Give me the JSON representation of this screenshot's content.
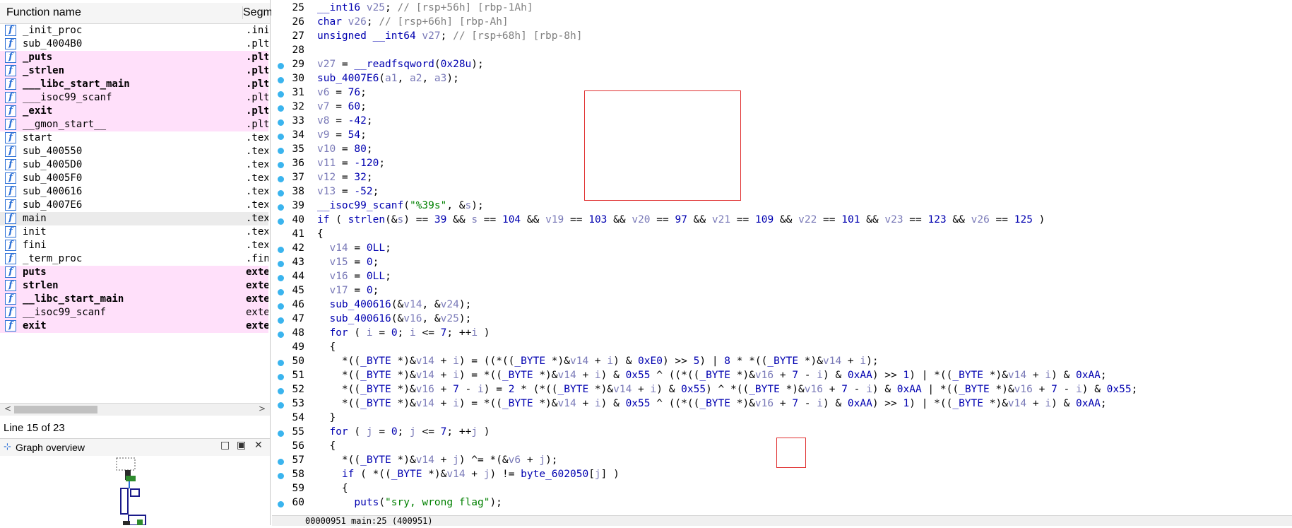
{
  "function_list": {
    "header_name": "Function name",
    "header_segment": "Segment",
    "icon_glyph": "f",
    "rows": [
      {
        "name": "_init_proc",
        "seg": ".init",
        "hl": false,
        "bold": false
      },
      {
        "name": "sub_4004B0",
        "seg": ".plt",
        "hl": false,
        "bold": false
      },
      {
        "name": "_puts",
        "seg": ".plt",
        "hl": true,
        "bold": true
      },
      {
        "name": "_strlen",
        "seg": ".plt",
        "hl": true,
        "bold": true
      },
      {
        "name": "___libc_start_main",
        "seg": ".plt",
        "hl": true,
        "bold": true
      },
      {
        "name": "___isoc99_scanf",
        "seg": ".plt",
        "hl": true,
        "bold": false
      },
      {
        "name": "_exit",
        "seg": ".plt",
        "hl": true,
        "bold": true
      },
      {
        "name": "__gmon_start__",
        "seg": ".plt",
        "hl": true,
        "bold": false
      },
      {
        "name": "start",
        "seg": ".text",
        "hl": false,
        "bold": false
      },
      {
        "name": "sub_400550",
        "seg": ".text",
        "hl": false,
        "bold": false
      },
      {
        "name": "sub_4005D0",
        "seg": ".text",
        "hl": false,
        "bold": false
      },
      {
        "name": "sub_4005F0",
        "seg": ".text",
        "hl": false,
        "bold": false
      },
      {
        "name": "sub_400616",
        "seg": ".text",
        "hl": false,
        "bold": false
      },
      {
        "name": "sub_4007E6",
        "seg": ".text",
        "hl": false,
        "bold": false
      },
      {
        "name": "main",
        "seg": ".text",
        "hl": false,
        "bold": false,
        "sel": true
      },
      {
        "name": "init",
        "seg": ".text",
        "hl": false,
        "bold": false
      },
      {
        "name": "fini",
        "seg": ".text",
        "hl": false,
        "bold": false
      },
      {
        "name": "_term_proc",
        "seg": ".fini",
        "hl": false,
        "bold": false
      },
      {
        "name": "puts",
        "seg": "extern",
        "hl": true,
        "bold": true
      },
      {
        "name": "strlen",
        "seg": "extern",
        "hl": true,
        "bold": true
      },
      {
        "name": "__libc_start_main",
        "seg": "extern",
        "hl": true,
        "bold": true
      },
      {
        "name": "__isoc99_scanf",
        "seg": "extern",
        "hl": true,
        "bold": false
      },
      {
        "name": "exit",
        "seg": "extern",
        "hl": true,
        "bold": true
      }
    ],
    "status": "Line 15 of 23"
  },
  "graph_overview": {
    "title": "Graph overview",
    "pin_glyph": "□",
    "float_glyph": "▣",
    "close_glyph": "✕"
  },
  "scroll": {
    "left_arrow": "<",
    "right_arrow": ">"
  },
  "code": {
    "lines": [
      {
        "n": "25",
        "dot": false,
        "html": "<span class=\"k\">__int16</span> <span class=\"v\">v25</span>; <span class=\"g\">// [rsp+56h] [rbp-1Ah]</span>"
      },
      {
        "n": "26",
        "dot": false,
        "html": "<span class=\"k\">char</span> <span class=\"v\">v26</span>; <span class=\"g\">// [rsp+66h] [rbp-Ah]</span>"
      },
      {
        "n": "27",
        "dot": false,
        "html": "<span class=\"k\">unsigned __int64</span> <span class=\"v\">v27</span>; <span class=\"g\">// [rsp+68h] [rbp-8h]</span>"
      },
      {
        "n": "28",
        "dot": false,
        "html": ""
      },
      {
        "n": "29",
        "dot": true,
        "html": "<span class=\"v\">v27</span> = <span class=\"k\">__readfsqword</span>(<span class=\"k\">0x28u</span>);"
      },
      {
        "n": "30",
        "dot": true,
        "html": "<span class=\"k\">sub_4007E6</span>(<span class=\"v\">a1</span>, <span class=\"v\">a2</span>, <span class=\"v\">a3</span>);"
      },
      {
        "n": "31",
        "dot": true,
        "html": "<span class=\"v\">v6</span> = <span class=\"k\">76</span>;"
      },
      {
        "n": "32",
        "dot": true,
        "html": "<span class=\"v\">v7</span> = <span class=\"k\">60</span>;"
      },
      {
        "n": "33",
        "dot": true,
        "html": "<span class=\"v\">v8</span> = <span class=\"k\">-42</span>;"
      },
      {
        "n": "34",
        "dot": true,
        "html": "<span class=\"v\">v9</span> = <span class=\"k\">54</span>;"
      },
      {
        "n": "35",
        "dot": true,
        "html": "<span class=\"v\">v10</span> = <span class=\"k\">80</span>;"
      },
      {
        "n": "36",
        "dot": true,
        "html": "<span class=\"v\">v11</span> = <span class=\"k\">-120</span>;"
      },
      {
        "n": "37",
        "dot": true,
        "html": "<span class=\"v\">v12</span> = <span class=\"k\">32</span>;"
      },
      {
        "n": "38",
        "dot": true,
        "html": "<span class=\"v\">v13</span> = <span class=\"k\">-52</span>;"
      },
      {
        "n": "39",
        "dot": true,
        "html": "<span class=\"k\">__isoc99_scanf</span>(<span class=\"s\">\"%39s\"</span>, &amp;<span class=\"v\">s</span>);"
      },
      {
        "n": "40",
        "dot": true,
        "html": "<span class=\"k\">if</span> ( <span class=\"k\">strlen</span>(&amp;<span class=\"v\">s</span>) == <span class=\"k\">39</span> &amp;&amp; <span class=\"v\">s</span> == <span class=\"k\">104</span> &amp;&amp; <span class=\"v\">v19</span> == <span class=\"k\">103</span> &amp;&amp; <span class=\"v\">v20</span> == <span class=\"k\">97</span> &amp;&amp; <span class=\"v\">v21</span> == <span class=\"k\">109</span> &amp;&amp; <span class=\"v\">v22</span> == <span class=\"k\">101</span> &amp;&amp; <span class=\"v\">v23</span> == <span class=\"k\">123</span> &amp;&amp; <span class=\"v\">v26</span> == <span class=\"k\">125</span> )"
      },
      {
        "n": "41",
        "dot": false,
        "html": "{"
      },
      {
        "n": "42",
        "dot": true,
        "html": "  <span class=\"v\">v14</span> = <span class=\"k\">0LL</span>;"
      },
      {
        "n": "43",
        "dot": true,
        "html": "  <span class=\"v\">v15</span> = <span class=\"k\">0</span>;"
      },
      {
        "n": "44",
        "dot": true,
        "html": "  <span class=\"v\">v16</span> = <span class=\"k\">0LL</span>;"
      },
      {
        "n": "45",
        "dot": true,
        "html": "  <span class=\"v\">v17</span> = <span class=\"k\">0</span>;"
      },
      {
        "n": "46",
        "dot": true,
        "html": "  <span class=\"k\">sub_400616</span>(&amp;<span class=\"v\">v14</span>, &amp;<span class=\"v\">v24</span>);"
      },
      {
        "n": "47",
        "dot": true,
        "html": "  <span class=\"k\">sub_400616</span>(&amp;<span class=\"v\">v16</span>, &amp;<span class=\"v\">v25</span>);"
      },
      {
        "n": "48",
        "dot": true,
        "html": "  <span class=\"k\">for</span> ( <span class=\"v\">i</span> = <span class=\"k\">0</span>; <span class=\"v\">i</span> &lt;= <span class=\"k\">7</span>; ++<span class=\"v\">i</span> )"
      },
      {
        "n": "49",
        "dot": false,
        "html": "  {"
      },
      {
        "n": "50",
        "dot": true,
        "html": "    *((<span class=\"k\">_BYTE</span> *)&amp;<span class=\"v\">v14</span> + <span class=\"v\">i</span>) = ((*((<span class=\"k\">_BYTE</span> *)&amp;<span class=\"v\">v14</span> + <span class=\"v\">i</span>) &amp; <span class=\"k\">0xE0</span>) &gt;&gt; <span class=\"k\">5</span>) | <span class=\"k\">8</span> * *((<span class=\"k\">_BYTE</span> *)&amp;<span class=\"v\">v14</span> + <span class=\"v\">i</span>);"
      },
      {
        "n": "51",
        "dot": true,
        "html": "    *((<span class=\"k\">_BYTE</span> *)&amp;<span class=\"v\">v14</span> + <span class=\"v\">i</span>) = *((<span class=\"k\">_BYTE</span> *)&amp;<span class=\"v\">v14</span> + <span class=\"v\">i</span>) &amp; <span class=\"k\">0x55</span> ^ ((*((<span class=\"k\">_BYTE</span> *)&amp;<span class=\"v\">v16</span> + <span class=\"k\">7</span> - <span class=\"v\">i</span>) &amp; <span class=\"k\">0xAA</span>) &gt;&gt; <span class=\"k\">1</span>) | *((<span class=\"k\">_BYTE</span> *)&amp;<span class=\"v\">v14</span> + <span class=\"v\">i</span>) &amp; <span class=\"k\">0xAA</span>;"
      },
      {
        "n": "52",
        "dot": true,
        "html": "    *((<span class=\"k\">_BYTE</span> *)&amp;<span class=\"v\">v16</span> + <span class=\"k\">7</span> - <span class=\"v\">i</span>) = <span class=\"k\">2</span> * (*((<span class=\"k\">_BYTE</span> *)&amp;<span class=\"v\">v14</span> + <span class=\"v\">i</span>) &amp; <span class=\"k\">0x55</span>) ^ *((<span class=\"k\">_BYTE</span> *)&amp;<span class=\"v\">v16</span> + <span class=\"k\">7</span> - <span class=\"v\">i</span>) &amp; <span class=\"k\">0xAA</span> | *((<span class=\"k\">_BYTE</span> *)&amp;<span class=\"v\">v16</span> + <span class=\"k\">7</span> - <span class=\"v\">i</span>) &amp; <span class=\"k\">0x55</span>;"
      },
      {
        "n": "53",
        "dot": true,
        "html": "    *((<span class=\"k\">_BYTE</span> *)&amp;<span class=\"v\">v14</span> + <span class=\"v\">i</span>) = *((<span class=\"k\">_BYTE</span> *)&amp;<span class=\"v\">v14</span> + <span class=\"v\">i</span>) &amp; <span class=\"k\">0x55</span> ^ ((*((<span class=\"k\">_BYTE</span> *)&amp;<span class=\"v\">v16</span> + <span class=\"k\">7</span> - <span class=\"v\">i</span>) &amp; <span class=\"k\">0xAA</span>) &gt;&gt; <span class=\"k\">1</span>) | *((<span class=\"k\">_BYTE</span> *)&amp;<span class=\"v\">v14</span> + <span class=\"v\">i</span>) &amp; <span class=\"k\">0xAA</span>;"
      },
      {
        "n": "54",
        "dot": false,
        "html": "  }"
      },
      {
        "n": "55",
        "dot": true,
        "html": "  <span class=\"k\">for</span> ( <span class=\"v\">j</span> = <span class=\"k\">0</span>; <span class=\"v\">j</span> &lt;= <span class=\"k\">7</span>; ++<span class=\"v\">j</span> )"
      },
      {
        "n": "56",
        "dot": false,
        "html": "  {"
      },
      {
        "n": "57",
        "dot": true,
        "html": "    *((<span class=\"k\">_BYTE</span> *)&amp;<span class=\"v\">v14</span> + <span class=\"v\">j</span>) ^= *(&amp;<span class=\"v\">v6</span> + <span class=\"v\">j</span>);"
      },
      {
        "n": "58",
        "dot": true,
        "html": "    <span class=\"k\">if</span> ( *((<span class=\"k\">_BYTE</span> *)&amp;<span class=\"v\">v14</span> + <span class=\"v\">j</span>) != <span class=\"k\">byte_602050</span>[<span class=\"v\">j</span>] )"
      },
      {
        "n": "59",
        "dot": false,
        "html": "    {"
      },
      {
        "n": "60",
        "dot": true,
        "html": "      <span class=\"k\">puts</span>(<span class=\"s\">\"sry, wrong flag\"</span>);"
      }
    ],
    "bottom_status": "00000951 main:25 (400951)"
  },
  "colors": {
    "highlight_row": "#ffe0fa",
    "breakpoint_dot": "#3ab4ee",
    "keyword": "#0000b0",
    "variable": "#7a7ab8",
    "string": "#008000",
    "comment": "#808080",
    "annotation_box": "#e03030"
  }
}
